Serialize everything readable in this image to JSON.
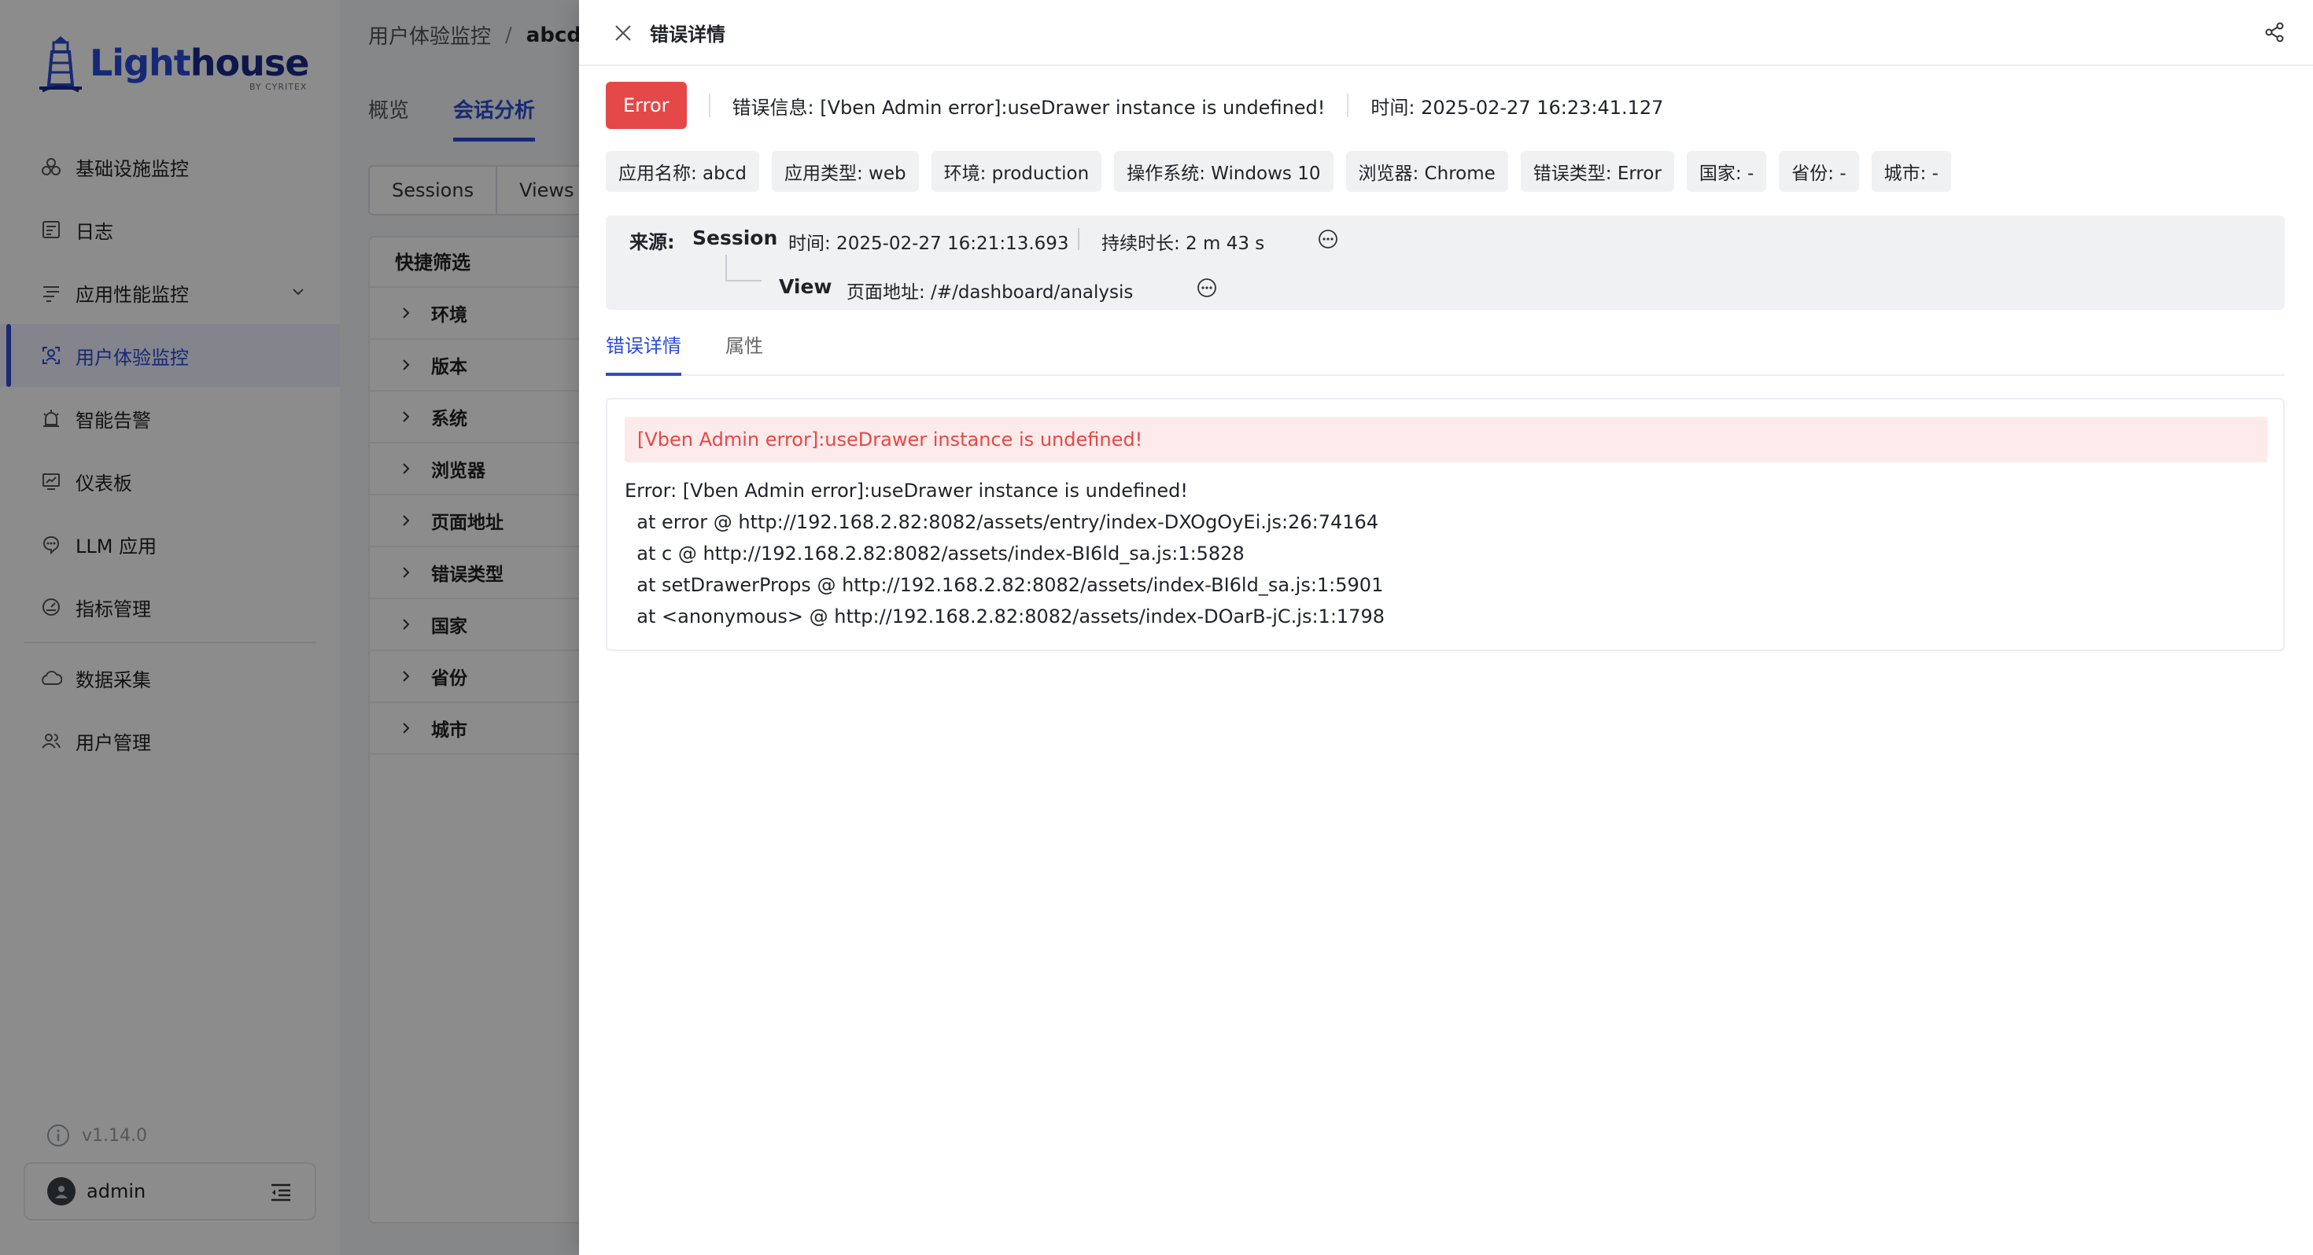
{
  "brand": {
    "name_part1": "Light",
    "name_part2": "house",
    "sub": "BY CYRITEX"
  },
  "sidebar": {
    "items": [
      {
        "label": "基础设施监控",
        "icon": "infrastructure-icon"
      },
      {
        "label": "日志",
        "icon": "log-icon"
      },
      {
        "label": "应用性能监控",
        "icon": "apm-icon",
        "expandable": true
      },
      {
        "label": "用户体验监控",
        "icon": "user-experience-icon",
        "active": true
      },
      {
        "label": "智能告警",
        "icon": "alarm-icon"
      },
      {
        "label": "仪表板",
        "icon": "dashboard-icon"
      },
      {
        "label": "LLM 应用",
        "icon": "llm-icon"
      },
      {
        "label": "指标管理",
        "icon": "metrics-icon"
      },
      {
        "label": "数据采集",
        "icon": "data-collection-icon"
      },
      {
        "label": "用户管理",
        "icon": "users-icon"
      }
    ],
    "version": "v1.14.0",
    "user": "admin"
  },
  "main": {
    "breadcrumb": {
      "root": "用户体验监控",
      "sep": "/",
      "current": "abcd"
    },
    "tabs": [
      {
        "label": "概览"
      },
      {
        "label": "会话分析",
        "active": true
      }
    ],
    "segments": [
      "Sessions",
      "Views"
    ],
    "filter": {
      "title": "快捷筛选",
      "items": [
        "环境",
        "版本",
        "系统",
        "浏览器",
        "页面地址",
        "错误类型",
        "国家",
        "省份",
        "城市"
      ]
    }
  },
  "drawer": {
    "title": "错误详情",
    "badge": "Error",
    "message": "错误信息: [Vben Admin error]:useDrawer instance is undefined!",
    "time": "时间: 2025-02-27 16:23:41.127",
    "tags": [
      "应用名称: abcd",
      "应用类型: web",
      "环境: production",
      "操作系统: Windows 10",
      "浏览器: Chrome",
      "错误类型: Error",
      "国家: -",
      "省份: -",
      "城市: -"
    ],
    "source": {
      "label": "来源:",
      "session": "Session",
      "session_time": "时间: 2025-02-27 16:21:13.693",
      "duration": "持续时长: 2 m 43 s",
      "view": "View",
      "view_url": "页面地址: /#/dashboard/analysis"
    },
    "tabs": [
      {
        "label": "错误详情",
        "active": true
      },
      {
        "label": "属性"
      }
    ],
    "alert": "[Vben Admin error]:useDrawer instance is undefined!",
    "stack": "Error: [Vben Admin error]:useDrawer instance is undefined!\n  at error @ http://192.168.2.82:8082/assets/entry/index-DXOgOyEi.js:26:74164\n  at c @ http://192.168.2.82:8082/assets/index-BI6ld_sa.js:1:5828\n  at setDrawerProps @ http://192.168.2.82:8082/assets/index-BI6ld_sa.js:1:5901\n  at <anonymous> @ http://192.168.2.82:8082/assets/index-DOarB-jC.js:1:1798"
  },
  "colors": {
    "accent": "#2b4bd6",
    "error": "#e54848",
    "error_bg": "#fdeaea"
  }
}
